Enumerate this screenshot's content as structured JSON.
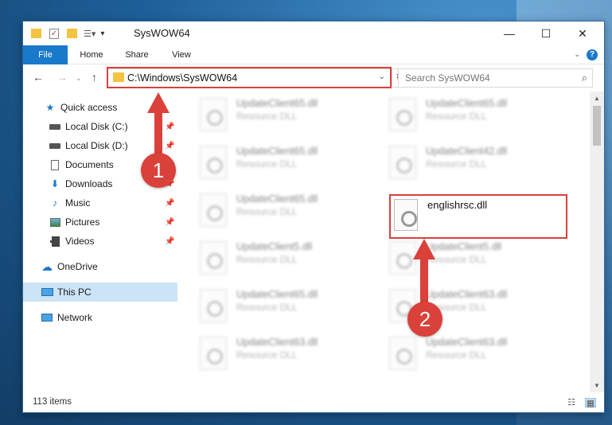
{
  "window": {
    "title": "SysWOW64",
    "controls": {
      "minimize": "—",
      "maximize": "☐",
      "close": "✕"
    }
  },
  "ribbon": {
    "tabs": [
      {
        "label": "File",
        "active": true
      },
      {
        "label": "Home"
      },
      {
        "label": "Share"
      },
      {
        "label": "View"
      }
    ],
    "help": "?"
  },
  "address_bar": {
    "path": "C:\\Windows\\SysWOW64"
  },
  "search": {
    "placeholder": "Search SysWOW64"
  },
  "sidebar": {
    "items": [
      {
        "label": "Quick access",
        "icon": "star-icon",
        "pinned": false
      },
      {
        "label": "Local Disk (C:)",
        "icon": "drive-icon",
        "pinned": true
      },
      {
        "label": "Local Disk (D:)",
        "icon": "drive-icon",
        "pinned": true
      },
      {
        "label": "Documents",
        "icon": "document-icon",
        "pinned": true
      },
      {
        "label": "Downloads",
        "icon": "download-icon",
        "pinned": true
      },
      {
        "label": "Music",
        "icon": "music-icon",
        "pinned": true
      },
      {
        "label": "Pictures",
        "icon": "pictures-icon",
        "pinned": true
      },
      {
        "label": "Videos",
        "icon": "video-icon",
        "pinned": true
      },
      {
        "label": "OneDrive",
        "icon": "cloud-icon",
        "pinned": false
      },
      {
        "label": "This PC",
        "icon": "computer-icon",
        "pinned": false,
        "active": true
      },
      {
        "label": "Network",
        "icon": "network-icon",
        "pinned": false
      }
    ]
  },
  "files": [
    {
      "name": "UpdateClient65.dll",
      "type": "Resource DLL"
    },
    {
      "name": "UpdateClient65.dll",
      "type": "Resource DLL"
    },
    {
      "name": "UpdateClient65.dll",
      "type": "Resource DLL"
    },
    {
      "name": "UpdateClient42.dll",
      "type": "Resource DLL"
    },
    {
      "name": "UpdateClient65.dll",
      "type": "Resource DLL"
    },
    {
      "name": "UpdateClient5.dll",
      "type": "Resource DLL"
    },
    {
      "name": "UpdateClient5.dll",
      "type": "Resource DLL"
    },
    {
      "name": "UpdateClient65.dll",
      "type": "Resource DLL"
    },
    {
      "name": "UpdateClient63.dll",
      "type": "Resource DLL"
    },
    {
      "name": "UpdateClient63.dll",
      "type": "Resource DLL"
    },
    {
      "name": "UpdateClient63.dll",
      "type": "Resource DLL"
    }
  ],
  "highlighted_file": {
    "name": "englishrsc.dll"
  },
  "status": {
    "item_count": "113 items"
  },
  "annotations": {
    "step1": "1",
    "step2": "2",
    "color": "#d9413a"
  }
}
